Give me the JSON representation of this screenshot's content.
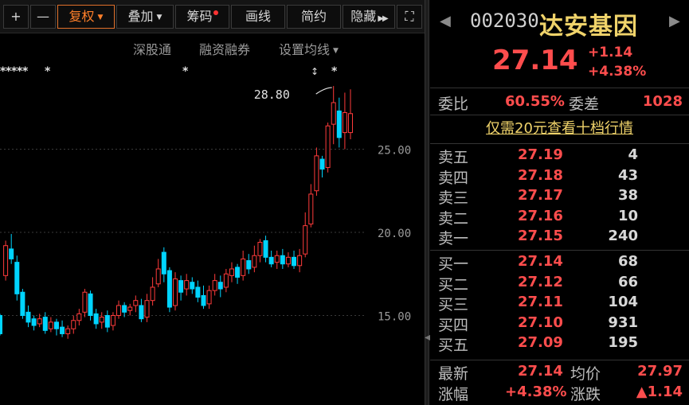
{
  "toolbar": {
    "plus": "+",
    "minus": "—",
    "fuquan": "复权",
    "diejia": "叠加",
    "chouma": "筹码",
    "huaxian": "画线",
    "jianyue": "简约",
    "yincang": "隐藏",
    "fullscreen": "⛶"
  },
  "subbar": {
    "shengutong": "深股通",
    "rongzi": "融资融券",
    "junxian": "设置均线"
  },
  "chart_data": {
    "type": "candlestick",
    "y_ticks": [
      {
        "label": "25.00",
        "value": 25.0
      },
      {
        "label": "20.00",
        "value": 20.0
      },
      {
        "label": "15.00",
        "value": 15.0
      }
    ],
    "high_label": "28.80",
    "markers": "*",
    "up_color": "#ff3b3b",
    "down_color": "#00d4ff",
    "candles": [
      [
        15.0,
        13.9,
        15.1,
        13.8
      ],
      [
        17.4,
        19.2,
        19.5,
        17.1
      ],
      [
        19.0,
        18.4,
        19.9,
        18.1
      ],
      [
        18.2,
        16.3,
        18.6,
        15.9
      ],
      [
        16.4,
        15.0,
        16.6,
        14.8
      ],
      [
        15.2,
        14.6,
        15.6,
        14.3
      ],
      [
        14.8,
        14.4,
        15.0,
        14.1
      ],
      [
        14.5,
        14.8,
        15.1,
        14.3
      ],
      [
        14.9,
        14.1,
        15.2,
        13.9
      ],
      [
        14.2,
        14.6,
        14.9,
        14.0
      ],
      [
        14.6,
        14.2,
        14.8,
        13.8
      ],
      [
        14.3,
        13.9,
        14.7,
        13.7
      ],
      [
        13.9,
        14.2,
        14.4,
        13.6
      ],
      [
        14.2,
        14.7,
        15.0,
        13.9
      ],
      [
        14.7,
        15.1,
        15.4,
        14.4
      ],
      [
        15.2,
        16.4,
        16.6,
        14.9
      ],
      [
        16.3,
        15.0,
        16.5,
        14.7
      ],
      [
        15.1,
        14.5,
        15.4,
        14.2
      ],
      [
        14.6,
        14.9,
        15.2,
        14.2
      ],
      [
        15.0,
        14.3,
        15.3,
        14.0
      ],
      [
        14.4,
        15.0,
        15.2,
        14.1
      ],
      [
        15.0,
        15.6,
        15.9,
        14.8
      ],
      [
        15.6,
        15.2,
        15.8,
        14.9
      ],
      [
        15.3,
        15.5,
        15.7,
        15.0
      ],
      [
        15.6,
        15.9,
        16.2,
        15.2
      ],
      [
        15.6,
        14.8,
        16.0,
        14.6
      ],
      [
        14.9,
        15.9,
        16.3,
        14.6
      ],
      [
        15.9,
        16.7,
        17.3,
        15.6
      ],
      [
        16.9,
        17.8,
        18.4,
        16.7
      ],
      [
        18.8,
        17.5,
        19.1,
        17.0
      ],
      [
        17.7,
        15.5,
        17.9,
        15.2
      ],
      [
        15.6,
        17.2,
        17.6,
        15.3
      ],
      [
        17.1,
        16.4,
        17.4,
        15.9
      ],
      [
        16.6,
        17.1,
        17.5,
        16.2
      ],
      [
        17.0,
        16.6,
        17.3,
        16.3
      ],
      [
        16.7,
        16.1,
        17.1,
        15.8
      ],
      [
        16.2,
        15.6,
        16.8,
        15.4
      ],
      [
        15.7,
        16.5,
        16.8,
        15.4
      ],
      [
        16.5,
        17.1,
        17.5,
        16.2
      ],
      [
        17.0,
        16.6,
        17.4,
        16.1
      ],
      [
        16.7,
        17.5,
        17.8,
        16.4
      ],
      [
        17.4,
        17.8,
        18.2,
        17.0
      ],
      [
        17.9,
        17.3,
        18.1,
        16.9
      ],
      [
        17.4,
        18.4,
        18.9,
        17.1
      ],
      [
        18.3,
        17.8,
        18.7,
        17.5
      ],
      [
        17.9,
        18.6,
        19.2,
        17.6
      ],
      [
        18.6,
        19.4,
        19.6,
        18.2
      ],
      [
        19.5,
        18.5,
        19.8,
        18.2
      ],
      [
        18.5,
        18.1,
        18.9,
        17.9
      ],
      [
        18.2,
        18.6,
        18.9,
        17.8
      ],
      [
        18.6,
        18.1,
        19.0,
        17.8
      ],
      [
        18.1,
        18.5,
        18.8,
        17.9
      ],
      [
        18.5,
        18.0,
        18.9,
        17.8
      ],
      [
        18.0,
        18.6,
        19.0,
        17.6
      ],
      [
        18.7,
        20.4,
        21.2,
        18.5
      ],
      [
        20.5,
        22.3,
        22.9,
        20.3
      ],
      [
        22.5,
        24.6,
        25.1,
        22.2
      ],
      [
        24.4,
        23.8,
        24.6,
        23.3
      ],
      [
        23.9,
        26.4,
        26.6,
        23.6
      ],
      [
        26.5,
        27.8,
        28.8,
        25.3
      ],
      [
        27.3,
        25.7,
        28.1,
        25.1
      ],
      [
        26.0,
        27.2,
        28.4,
        25.0
      ],
      [
        26.0,
        27.14,
        28.6,
        25.6
      ]
    ]
  },
  "quote": {
    "code": "002030",
    "name": "达安基因",
    "price": "27.14",
    "change": "+1.14",
    "change_pct": "+4.38%",
    "weibi_label": "委比",
    "weibi": "60.55%",
    "weicha_label": "委差",
    "weicha": "1028",
    "promo": "仅需20元查看十档行情",
    "asks": [
      {
        "label": "卖五",
        "price": "27.19",
        "vol": "4"
      },
      {
        "label": "卖四",
        "price": "27.18",
        "vol": "43"
      },
      {
        "label": "卖三",
        "price": "27.17",
        "vol": "38"
      },
      {
        "label": "卖二",
        "price": "27.16",
        "vol": "10"
      },
      {
        "label": "卖一",
        "price": "27.15",
        "vol": "240"
      }
    ],
    "bids": [
      {
        "label": "买一",
        "price": "27.14",
        "vol": "68"
      },
      {
        "label": "买二",
        "price": "27.12",
        "vol": "66"
      },
      {
        "label": "买三",
        "price": "27.11",
        "vol": "104"
      },
      {
        "label": "买四",
        "price": "27.10",
        "vol": "931"
      },
      {
        "label": "买五",
        "price": "27.09",
        "vol": "195"
      }
    ],
    "latest_label": "最新",
    "latest": "27.14",
    "avg_label": "均价",
    "avg": "27.97",
    "pct_label": "涨幅",
    "pct": "+4.38%",
    "diff_label": "涨跌",
    "diff": "▲1.14"
  },
  "colors": {
    "up": "#ff4d4d",
    "down": "#00d4ff",
    "name": "#f0d36a",
    "active": "#ff7f2a"
  }
}
